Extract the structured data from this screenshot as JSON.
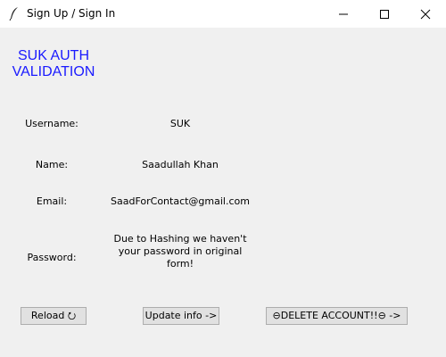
{
  "window": {
    "title": "Sign Up / Sign In",
    "icon": "feather-icon"
  },
  "heading": "SUK AUTH\nVALIDATION",
  "fields": {
    "username": {
      "label": "Username:",
      "value": "SUK"
    },
    "name": {
      "label": "Name:",
      "value": "Saadullah Khan"
    },
    "email": {
      "label": "Email:",
      "value": "SaadForContact@gmail.com"
    },
    "password": {
      "label": "Password:",
      "value": "Due to Hashing we haven't your password in original form!"
    }
  },
  "buttons": {
    "reload": "Reload ⭮",
    "update": "Update info ->",
    "delete": "⊖DELETE ACCOUNT!!⊖ ->"
  },
  "colors": {
    "heading": "#1a1aff",
    "background": "#f0f0f0",
    "button_bg": "#e1e1e1"
  }
}
